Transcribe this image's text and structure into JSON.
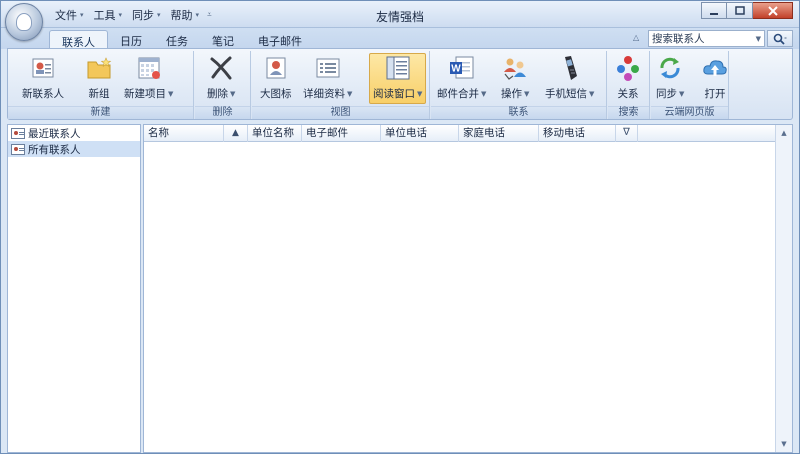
{
  "window": {
    "title": "友情强档"
  },
  "menu": [
    {
      "label": "文件",
      "arrow": "▾"
    },
    {
      "label": "工具",
      "arrow": "▾"
    },
    {
      "label": "同步",
      "arrow": "▾"
    },
    {
      "label": "帮助",
      "arrow": "▾"
    }
  ],
  "tabs": [
    "联系人",
    "日历",
    "任务",
    "笔记",
    "电子邮件"
  ],
  "search": {
    "value": "搜索联系人"
  },
  "ribbon": {
    "groups": [
      {
        "label": "新建",
        "buttons": [
          "新联系人",
          "新组",
          "新建项目"
        ]
      },
      {
        "label": "删除",
        "buttons": [
          "删除"
        ]
      },
      {
        "label": "视图",
        "buttons": [
          "大图标",
          "详细资料",
          "阅读窗口"
        ]
      },
      {
        "label": "联系",
        "buttons": [
          "邮件合并",
          "操作",
          "手机短信"
        ]
      },
      {
        "label": "搜索",
        "buttons": [
          "关系"
        ]
      },
      {
        "label": "云端网页版",
        "buttons": [
          "同步",
          "打开"
        ]
      }
    ]
  },
  "nav": [
    {
      "label": "最近联系人"
    },
    {
      "label": "所有联系人"
    }
  ],
  "columns": [
    "名称",
    "▲",
    "单位名称",
    "电子邮件",
    "单位电话",
    "家庭电话",
    "移动电话",
    "∇"
  ],
  "colors": {
    "accent": "#c4d6ee",
    "selected": "#cfe0f5",
    "active_button": "#f8cf68"
  }
}
